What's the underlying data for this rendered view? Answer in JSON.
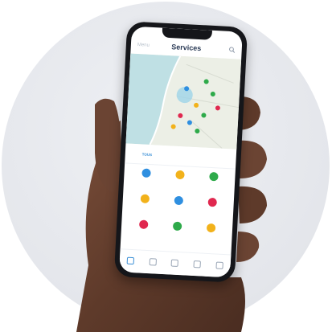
{
  "scene": {
    "description_colors": {
      "background": "#ffffff",
      "circle": "#e4e6eb",
      "skin": "#6b4433",
      "phone": "#15161a"
    }
  },
  "app": {
    "back_label": "Menu",
    "title": "Services",
    "search_icon": "search-icon"
  },
  "map": {
    "water_color": "#bfe0e4",
    "land_color": "#e9eee4"
  },
  "tabs": [
    {
      "label": "Tous",
      "sub": "",
      "active": true
    },
    {
      "label": "",
      "active": false
    },
    {
      "label": "",
      "active": false
    }
  ],
  "services": [
    {
      "color": "#2f8fe0",
      "label": ""
    },
    {
      "color": "#f2b21b",
      "label": ""
    },
    {
      "color": "#2eaa4a",
      "label": ""
    },
    {
      "color": "#f2b21b",
      "label": ""
    },
    {
      "color": "#2f8fe0",
      "label": ""
    },
    {
      "color": "#e0284f",
      "label": ""
    },
    {
      "color": "#e0284f",
      "label": ""
    },
    {
      "color": "#2eaa4a",
      "label": ""
    },
    {
      "color": "#f2b21b",
      "label": ""
    }
  ],
  "bottom_nav": [
    {
      "icon": "home-icon",
      "label": "",
      "active": true
    },
    {
      "icon": "services-icon",
      "label": "",
      "active": false
    },
    {
      "icon": "pin-icon",
      "label": "",
      "active": false
    },
    {
      "icon": "bell-icon",
      "label": "",
      "active": false
    },
    {
      "icon": "user-icon",
      "label": "",
      "active": false
    }
  ]
}
